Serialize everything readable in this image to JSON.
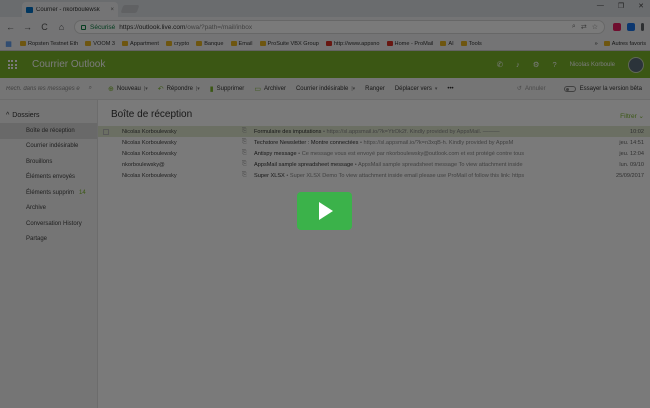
{
  "browser": {
    "tab_title": "Courrier - nkorboulewsk",
    "tab_close": "×",
    "window_controls": [
      "—",
      "❐",
      "✕"
    ],
    "nav": {
      "back": "←",
      "forward": "→",
      "reload": "C",
      "home": "⌂"
    },
    "secure_label": "Sécurisé",
    "url_main": "https://outlook.live.com",
    "url_rest": "/owa/?path=/mail/inbox",
    "bookmarks": [
      {
        "label": "Ropsten Testnet Eth",
        "icon": "folder"
      },
      {
        "label": "VOOM 3",
        "icon": "folder"
      },
      {
        "label": "Appartment",
        "icon": "folder"
      },
      {
        "label": "crypto",
        "icon": "folder"
      },
      {
        "label": "Banque",
        "icon": "folder"
      },
      {
        "label": "Email",
        "icon": "folder"
      },
      {
        "label": "ProSuite VBX Group",
        "icon": "folder"
      },
      {
        "label": "http://www.appsno",
        "icon": "page-red"
      },
      {
        "label": "Home - ProMail",
        "icon": "page-red"
      },
      {
        "label": "AI",
        "icon": "folder"
      },
      {
        "label": "Tools",
        "icon": "folder"
      }
    ],
    "bookmarks_more": "»",
    "bookmarks_other": "Autres favoris"
  },
  "app": {
    "name": "Courrier Outlook",
    "user": "Nicolas Korboule",
    "header_icons": [
      "skype-icon",
      "bell-icon",
      "gear-icon",
      "help-icon"
    ]
  },
  "toolbar": {
    "search_placeholder": "Rech. dans les messages e",
    "new": "Nouveau",
    "reply": "Répondre",
    "delete": "Supprimer",
    "archive": "Archiver",
    "junk": "Courrier indésirable",
    "sweep": "Ranger",
    "move": "Déplacer vers",
    "more": "•••",
    "undo": "Annuler",
    "beta": "Essayer la version bêta"
  },
  "folders": {
    "title": "Dossiers",
    "items": [
      {
        "label": "Boîte de réception",
        "count": ""
      },
      {
        "label": "Courrier indésirable",
        "count": ""
      },
      {
        "label": "Brouillons",
        "count": ""
      },
      {
        "label": "Éléments envoyés",
        "count": ""
      },
      {
        "label": "Éléments supprim",
        "count": "14"
      },
      {
        "label": "Archive",
        "count": ""
      },
      {
        "label": "Conversation History",
        "count": ""
      },
      {
        "label": "Partage",
        "count": ""
      }
    ]
  },
  "inbox": {
    "title": "Boîte de réception",
    "filter": "Filtrer",
    "messages": [
      {
        "from": "Nicolas Korboulewsky",
        "subject": "Formulaire des imputations",
        "preview": "https://sl.appsmail.io/?k=YtrDk2f. Kindly provided by AppsMail. ———",
        "date": "10:02"
      },
      {
        "from": "Nicolas Korboulewsky",
        "subject": "Techstore Newsletter : Montre connectées",
        "preview": "https://sl.appsmail.io/?k=n3xqB-h. Kindly provided by AppsM",
        "date": "jeu. 14:51"
      },
      {
        "from": "Nicolas Korboulewsky",
        "subject": "Antispy message",
        "preview": "Ce message vous est envoyé par nkorboulewsky@outlook.com et est protégé contre tous",
        "date": "jeu. 12:04"
      },
      {
        "from": "nkorboulewsky@",
        "subject": "AppsMail sample spreadsheet message",
        "preview": "AppsMail sample spreadsheet message To view attachment inside",
        "date": "lun. 09/10"
      },
      {
        "from": "Nicolas Korboulewsky",
        "subject": "Super XLSX",
        "preview": "Super XLSX Demo To view attachment inside email please use ProMail of follow this link: https",
        "date": "25/09/2017"
      }
    ]
  },
  "video": {
    "play_label": "▶"
  }
}
